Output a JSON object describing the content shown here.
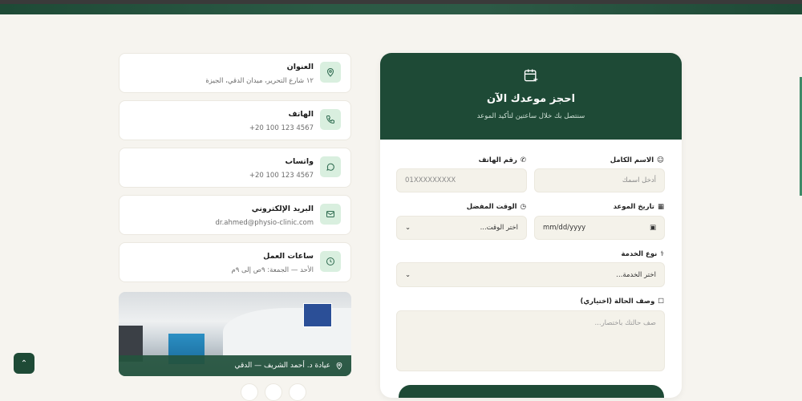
{
  "contact": [
    {
      "title": "العنوان",
      "value": "١٢ شارع التحرير، ميدان الدقي، الجيزة",
      "icon": "map-pin-icon"
    },
    {
      "title": "الهاتف",
      "value": "+20 100 123 4567",
      "icon": "phone-icon"
    },
    {
      "title": "واتساب",
      "value": "+20 100 123 4567",
      "icon": "whatsapp-icon"
    },
    {
      "title": "البريد الإلكتروني",
      "value": "dr.ahmed@physio-clinic.com",
      "icon": "mail-icon"
    },
    {
      "title": "ساعات العمل",
      "value": "الأحد — الجمعة: ٩ص إلى ٩م",
      "icon": "clock-icon"
    }
  ],
  "photo": {
    "caption": "عيادة د. أحمد الشريف — الدقي"
  },
  "form": {
    "title": "احجز موعدك الآن",
    "subtitle": "سنتصل بك خلال ساعتين لتأكيد الموعد",
    "name_label": "الاسم الكامل",
    "name_placeholder": "أدخل اسمك",
    "phone_label": "رقم الهاتف",
    "phone_placeholder": "01XXXXXXXXX",
    "date_label": "تاريخ الموعد",
    "date_value": "mm/dd/yyyy",
    "time_label": "الوقت المفضل",
    "time_value": "اختر الوقت...",
    "service_label": "نوع الخدمة",
    "service_value": "اختر الخدمة...",
    "desc_label": "وصف الحالة (اختياري)",
    "desc_placeholder": "صف حالتك باختصار..."
  }
}
